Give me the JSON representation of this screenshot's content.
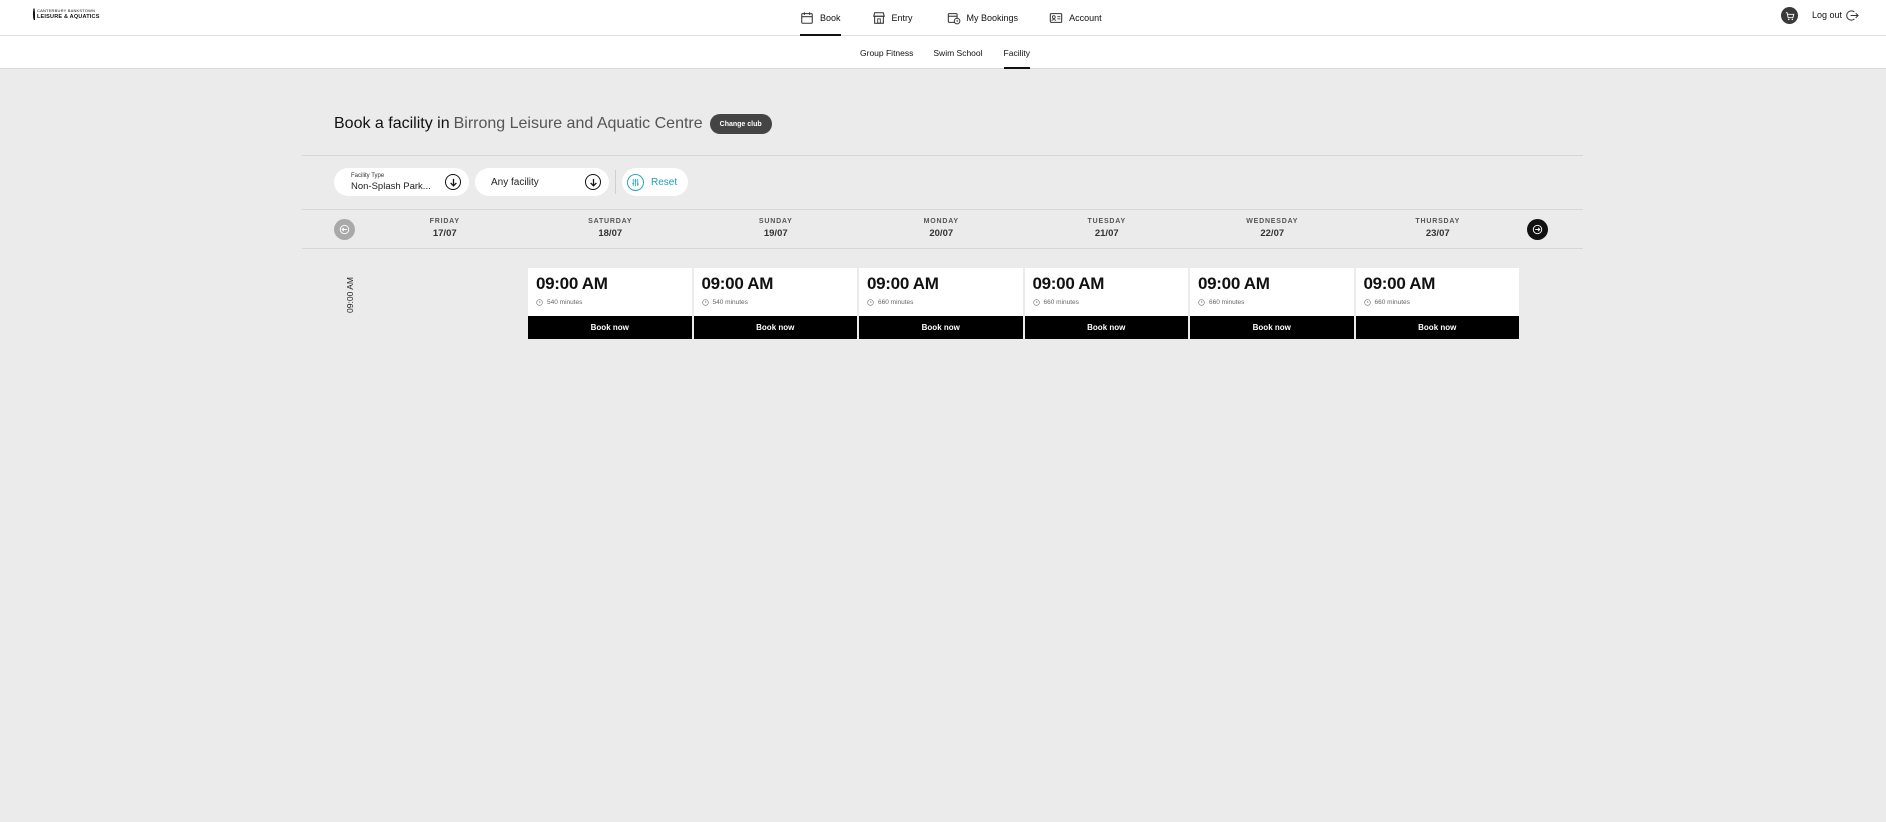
{
  "brand": {
    "line1": "CANTERBURY BANKSTOWN",
    "line2": "LEISURE & AQUATICS"
  },
  "nav": {
    "book": "Book",
    "entry": "Entry",
    "my_bookings": "My Bookings",
    "account": "Account"
  },
  "header": {
    "logout": "Log out"
  },
  "subnav": {
    "group_fitness": "Group Fitness",
    "swim_school": "Swim School",
    "facility": "Facility"
  },
  "title": {
    "prefix": "Book a facility in",
    "club": "Birrong Leisure and Aquatic Centre",
    "change_club": "Change club"
  },
  "filters": {
    "facility_type_label": "Facility Type",
    "facility_type_value": "Non-Splash Park...",
    "facility_value": "Any facility",
    "reset": "Reset"
  },
  "days": [
    {
      "name": "FRIDAY",
      "date": "17/07"
    },
    {
      "name": "SATURDAY",
      "date": "18/07"
    },
    {
      "name": "SUNDAY",
      "date": "19/07"
    },
    {
      "name": "MONDAY",
      "date": "20/07"
    },
    {
      "name": "TUESDAY",
      "date": "21/07"
    },
    {
      "name": "WEDNESDAY",
      "date": "22/07"
    },
    {
      "name": "THURSDAY",
      "date": "23/07"
    }
  ],
  "time_row_label": "09:00 AM",
  "slots": [
    {
      "time": "09:00 AM",
      "duration": "540 minutes",
      "button": "Book now"
    },
    {
      "time": "09:00 AM",
      "duration": "540 minutes",
      "button": "Book now"
    },
    {
      "time": "09:00 AM",
      "duration": "660 minutes",
      "button": "Book now"
    },
    {
      "time": "09:00 AM",
      "duration": "660 minutes",
      "button": "Book now"
    },
    {
      "time": "09:00 AM",
      "duration": "660 minutes",
      "button": "Book now"
    },
    {
      "time": "09:00 AM",
      "duration": "660 minutes",
      "button": "Book now"
    }
  ],
  "icons": {
    "book": "calendar-icon",
    "entry": "storefront-icon",
    "my_bookings": "calendar-clock-icon",
    "account": "id-card-icon",
    "cart": "cart-icon",
    "logout": "logout-arrow-icon",
    "dropdown": "arrow-down-circle-icon",
    "reset": "sliders-icon",
    "prev": "arrow-left-circle-icon",
    "next": "arrow-right-circle-icon",
    "duration": "clock-icon"
  }
}
